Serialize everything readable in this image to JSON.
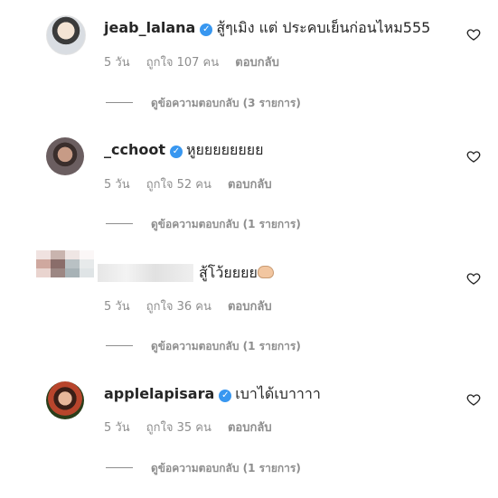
{
  "comments": [
    {
      "username": "jeab_lalana",
      "verified": true,
      "text": "สู้ๆเมิง แต่ ประคบเย็นก่อนไหม555",
      "time": "5 วัน",
      "likes": "ถูกใจ 107 คน",
      "reply_label": "ตอบกลับ",
      "view_replies": "ดูข้อความตอบกลับ (3 รายการ)"
    },
    {
      "username": "_cchoot",
      "verified": true,
      "text": "หูยยยยยยยย",
      "time": "5 วัน",
      "likes": "ถูกใจ 52 คน",
      "reply_label": "ตอบกลับ",
      "view_replies": "ดูข้อความตอบกลับ (1 รายการ)"
    },
    {
      "username": "",
      "verified": false,
      "text": "สู้โว้ยยยย",
      "emoji": "fist-emoji",
      "time": "5 วัน",
      "likes": "ถูกใจ 36 คน",
      "reply_label": "ตอบกลับ",
      "view_replies": "ดูข้อความตอบกลับ (1 รายการ)"
    },
    {
      "username": "applelapisara",
      "verified": true,
      "text": "เบาได้เบาาาา",
      "time": "5 วัน",
      "likes": "ถูกใจ 35 คน",
      "reply_label": "ตอบกลับ",
      "view_replies": "ดูข้อความตอบกลับ (1 รายการ)"
    }
  ],
  "icons": {
    "like": "heart-outline-icon",
    "verified": "verified-badge-icon"
  },
  "colors": {
    "verified": "#3897f0",
    "secondary_text": "#8e8e8e",
    "primary_text": "#262626"
  }
}
